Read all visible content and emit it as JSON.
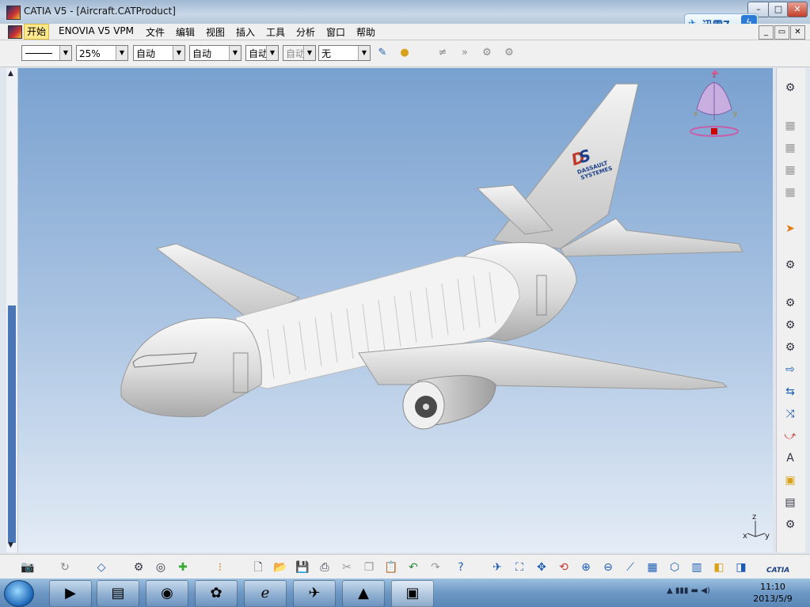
{
  "window": {
    "title": "CATIA V5 - [Aircraft.CATProduct]",
    "controls": [
      "–",
      "□",
      "✕"
    ],
    "mdi_controls": [
      "_",
      "▭",
      "✕"
    ]
  },
  "thunder": {
    "label": "迅雷7",
    "bolt": "ϟ"
  },
  "menu": {
    "items": [
      "开始",
      "ENOVIA V5 VPM",
      "文件",
      "编辑",
      "视图",
      "插入",
      "工具",
      "分析",
      "窗口",
      "帮助"
    ]
  },
  "toolbar": {
    "color_combo": "",
    "zoom_combo": "25%",
    "combo_3": "自动",
    "combo_4": "自动",
    "combo_5": "自动",
    "combo_6": "自动",
    "layer_combo": "无"
  },
  "viewport": {
    "logo_line1": "DASSAULT",
    "logo_line2": "SYSTEMES",
    "compass": {
      "z": "z",
      "x": "x",
      "y": "y"
    },
    "axes": {
      "z": "z",
      "x": "x",
      "y": "y"
    }
  },
  "brand": "CATIA",
  "clock": {
    "time": "11:10",
    "date": "2013/5/9"
  },
  "colors": {
    "accent": "#4a76b8",
    "sky_top": "#79a1cf",
    "sky_bottom": "#e4ecf6"
  }
}
